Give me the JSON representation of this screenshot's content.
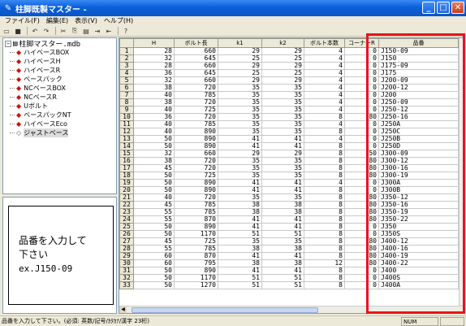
{
  "window": {
    "title": "柱脚既製マスター -"
  },
  "menu": [
    "ファイル(F)",
    "編集(E)",
    "表示(V)",
    "ヘルプ(H)"
  ],
  "toolbar_icons": [
    "new-icon",
    "save-icon",
    "undo-icon",
    "redo-icon",
    "cut-icon",
    "copy-icon",
    "paste-icon",
    "insert-row-icon",
    "delete-row-icon",
    "help-icon"
  ],
  "tree": {
    "root": "柱脚マスター.mdb",
    "items": [
      "ハイベースBOX",
      "ハイベースH",
      "ハイベースR",
      "ベースパック",
      "NCベースBOX",
      "NCベースR",
      "Uボルト",
      "ベースパックNT",
      "ハイベースEco",
      "ジャストベース"
    ],
    "selected_index": 9
  },
  "hint": {
    "line1": "品番を入力して",
    "line2": "下さい",
    "line3": "ex.J150-09"
  },
  "grid": {
    "columns": [
      "H",
      "ボルト長",
      "k1",
      "k2",
      "ボルト本数",
      "コーナーR",
      "品番"
    ],
    "rows": [
      [
        "1",
        "28",
        "660",
        "29",
        "29",
        "4",
        "0",
        "J150-09"
      ],
      [
        "2",
        "32",
        "645",
        "25",
        "25",
        "4",
        "0",
        "J150"
      ],
      [
        "3",
        "28",
        "660",
        "29",
        "29",
        "4",
        "0",
        "J175-09"
      ],
      [
        "4",
        "36",
        "645",
        "25",
        "25",
        "4",
        "0",
        "J175"
      ],
      [
        "5",
        "32",
        "660",
        "29",
        "29",
        "4",
        "0",
        "J200-09"
      ],
      [
        "6",
        "38",
        "720",
        "35",
        "35",
        "4",
        "0",
        "J200-12"
      ],
      [
        "7",
        "40",
        "785",
        "35",
        "35",
        "4",
        "0",
        "J200"
      ],
      [
        "8",
        "38",
        "720",
        "35",
        "35",
        "4",
        "0",
        "J250-09"
      ],
      [
        "9",
        "40",
        "725",
        "35",
        "35",
        "4",
        "0",
        "J250-12"
      ],
      [
        "10",
        "36",
        "720",
        "35",
        "35",
        "8",
        "80",
        "J250-16"
      ],
      [
        "11",
        "40",
        "785",
        "35",
        "35",
        "4",
        "0",
        "J250A"
      ],
      [
        "12",
        "40",
        "890",
        "35",
        "35",
        "8",
        "0",
        "J250C"
      ],
      [
        "13",
        "50",
        "890",
        "41",
        "41",
        "4",
        "0",
        "J250B"
      ],
      [
        "14",
        "50",
        "890",
        "41",
        "41",
        "8",
        "0",
        "J250D"
      ],
      [
        "15",
        "32",
        "660",
        "29",
        "29",
        "8",
        "50",
        "J300-09"
      ],
      [
        "16",
        "38",
        "720",
        "35",
        "35",
        "8",
        "80",
        "J300-12"
      ],
      [
        "17",
        "45",
        "720",
        "35",
        "35",
        "8",
        "80",
        "J300-16"
      ],
      [
        "18",
        "50",
        "725",
        "35",
        "35",
        "8",
        "80",
        "J300-19"
      ],
      [
        "19",
        "50",
        "890",
        "41",
        "41",
        "4",
        "0",
        "J300A"
      ],
      [
        "20",
        "50",
        "890",
        "41",
        "41",
        "8",
        "0",
        "J300B"
      ],
      [
        "21",
        "40",
        "720",
        "35",
        "35",
        "8",
        "80",
        "J350-12"
      ],
      [
        "22",
        "45",
        "785",
        "38",
        "38",
        "8",
        "80",
        "J350-16"
      ],
      [
        "23",
        "55",
        "785",
        "38",
        "38",
        "8",
        "80",
        "J350-19"
      ],
      [
        "24",
        "55",
        "870",
        "41",
        "41",
        "8",
        "80",
        "J350-22"
      ],
      [
        "25",
        "50",
        "890",
        "41",
        "41",
        "8",
        "0",
        "J350"
      ],
      [
        "26",
        "50",
        "1170",
        "51",
        "51",
        "8",
        "0",
        "J350S"
      ],
      [
        "27",
        "45",
        "725",
        "35",
        "35",
        "8",
        "80",
        "J400-12"
      ],
      [
        "28",
        "55",
        "785",
        "38",
        "38",
        "8",
        "80",
        "J400-16"
      ],
      [
        "29",
        "60",
        "870",
        "41",
        "41",
        "8",
        "80",
        "J400-19"
      ],
      [
        "30",
        "60",
        "795",
        "38",
        "38",
        "12",
        "80",
        "J400-22"
      ],
      [
        "31",
        "50",
        "890",
        "41",
        "41",
        "8",
        "0",
        "J400"
      ],
      [
        "32",
        "50",
        "1170",
        "51",
        "51",
        "8",
        "0",
        "J400S"
      ],
      [
        "33",
        "50",
        "1270",
        "51",
        "51",
        "8",
        "0",
        "J400A"
      ]
    ]
  },
  "status": {
    "text": "品番を入力して下さい。(必須: 英数/記号/ｶﾀｶﾅ/漢字 23桁)",
    "num": "NUM"
  },
  "colors": {
    "highlight": "#e8141a",
    "titlebar": "#0a5fd8",
    "tree_bullet": "#cc1010"
  }
}
